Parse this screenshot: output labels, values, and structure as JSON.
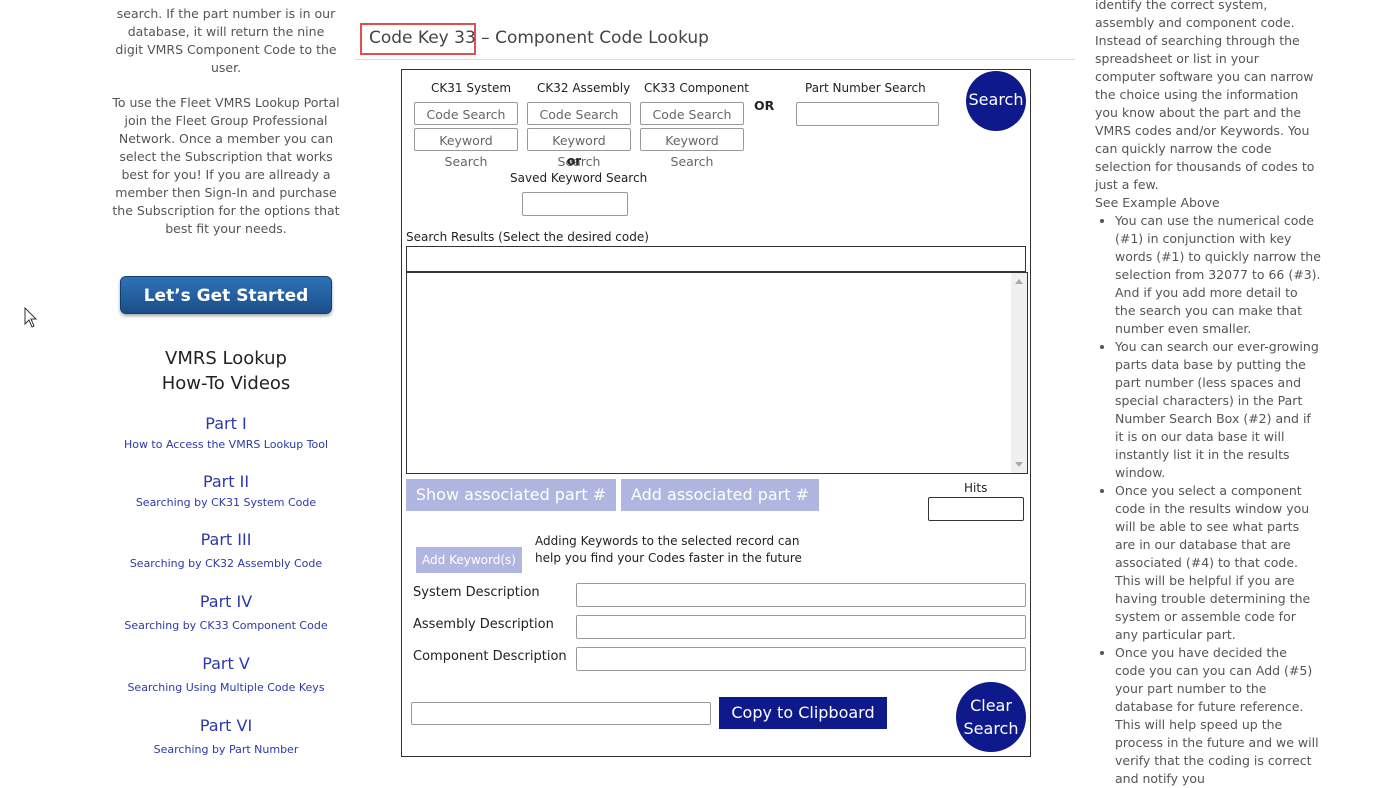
{
  "left": {
    "intro_tail": "search. If the part number is in our database, it will return the nine digit VMRS Component Code to the user.",
    "join_text": "To use the Fleet VMRS Lookup Portal join the Fleet Group Professional Network. Once a member you can select the Subscription that works best for you! If you are allready a member then Sign-In and purchase the Subscription for the options that best fit your needs.",
    "start_button": "Let’s Get Started",
    "videos_title_1": "VMRS Lookup",
    "videos_title_2": "How-To Videos",
    "videos": [
      {
        "title": "Part I",
        "subtitle": "How to Access the VMRS Lookup Tool"
      },
      {
        "title": "Part II",
        "subtitle": "Searching by CK31 System Code"
      },
      {
        "title": "Part III",
        "subtitle": "Searching by CK32 Assembly Code"
      },
      {
        "title": "Part IV",
        "subtitle": "Searching by CK33 Component Code"
      },
      {
        "title": "Part V",
        "subtitle": "Searching Using Multiple Code Keys"
      },
      {
        "title": "Part VI",
        "subtitle": "Searching by Part Number"
      }
    ]
  },
  "heading": {
    "highlight": "Code Key 33",
    "rest": " – Component Code Lookup"
  },
  "lookup": {
    "ck31": "CK31 System",
    "ck32": "CK32 Assembly",
    "ck33": "CK33 Component",
    "code_search": "Code Search",
    "keyword_search": "Keyword Search",
    "or_upper": "OR",
    "or_lower": "or",
    "saved_keyword": "Saved Keyword Search",
    "part_number_search": "Part Number Search",
    "search_button": "Search",
    "results_label": "Search Results (Select the desired code)",
    "show_assoc": "Show associated part #",
    "add_assoc": "Add associated part #",
    "hits": "Hits",
    "add_keywords_button": "Add Keyword(s)",
    "add_keywords_note_1": "Adding Keywords to the selected record can",
    "add_keywords_note_2": "help you find your Codes faster in the future",
    "system_desc": "System Description",
    "assembly_desc": "Assembly Description",
    "component_desc": "Component Description",
    "copy_button": "Copy to Clipboard",
    "clear_1": "Clear",
    "clear_2": "Search"
  },
  "right": {
    "intro_1": "identify the correct system,",
    "intro_2": "assembly and component code. Instead of searching through the spreadsheet or list in your computer software you can narrow the choice using the information you know about the part and the VMRS codes and/or Keywords. You can quickly narrow the code selection for thousands of codes to just a few.",
    "see_example": "See Example Above",
    "bullets": [
      "You can use the numerical code (#1) in conjunction with key words (#1) to quickly narrow the selection from 32077 to 66 (#3). And if you add more detail to the search you can make that number even smaller.",
      "You can search our ever-growing parts data base by putting the part number (less spaces and special characters) in the Part Number Search Box (#2) and if it is on our data base it will instantly list it in the results window.",
      "Once you select a component code in the results window you will be able to see what parts are in our database that are associated (#4) to that code. This will be helpful if you are having trouble determining the system or assemble code for any particular part.",
      "Once you have decided the code you can you can Add (#5) your part number to the database for future reference. This will help speed up the process in the future and we will verify that the coding is correct and notify you"
    ]
  }
}
